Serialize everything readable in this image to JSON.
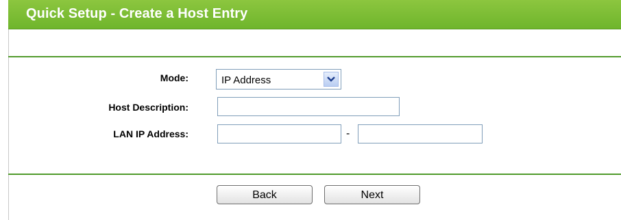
{
  "header": {
    "title": "Quick Setup - Create a Host Entry"
  },
  "form": {
    "mode": {
      "label": "Mode:",
      "value": "IP Address"
    },
    "host_description": {
      "label": "Host Description:",
      "value": ""
    },
    "lan_ip": {
      "label": "LAN IP Address:",
      "start_value": "",
      "end_value": "",
      "separator": "-"
    }
  },
  "buttons": {
    "back": "Back",
    "next": "Next"
  },
  "colors": {
    "title_bar": "#7bbd35",
    "separator": "#4f9a2a"
  }
}
